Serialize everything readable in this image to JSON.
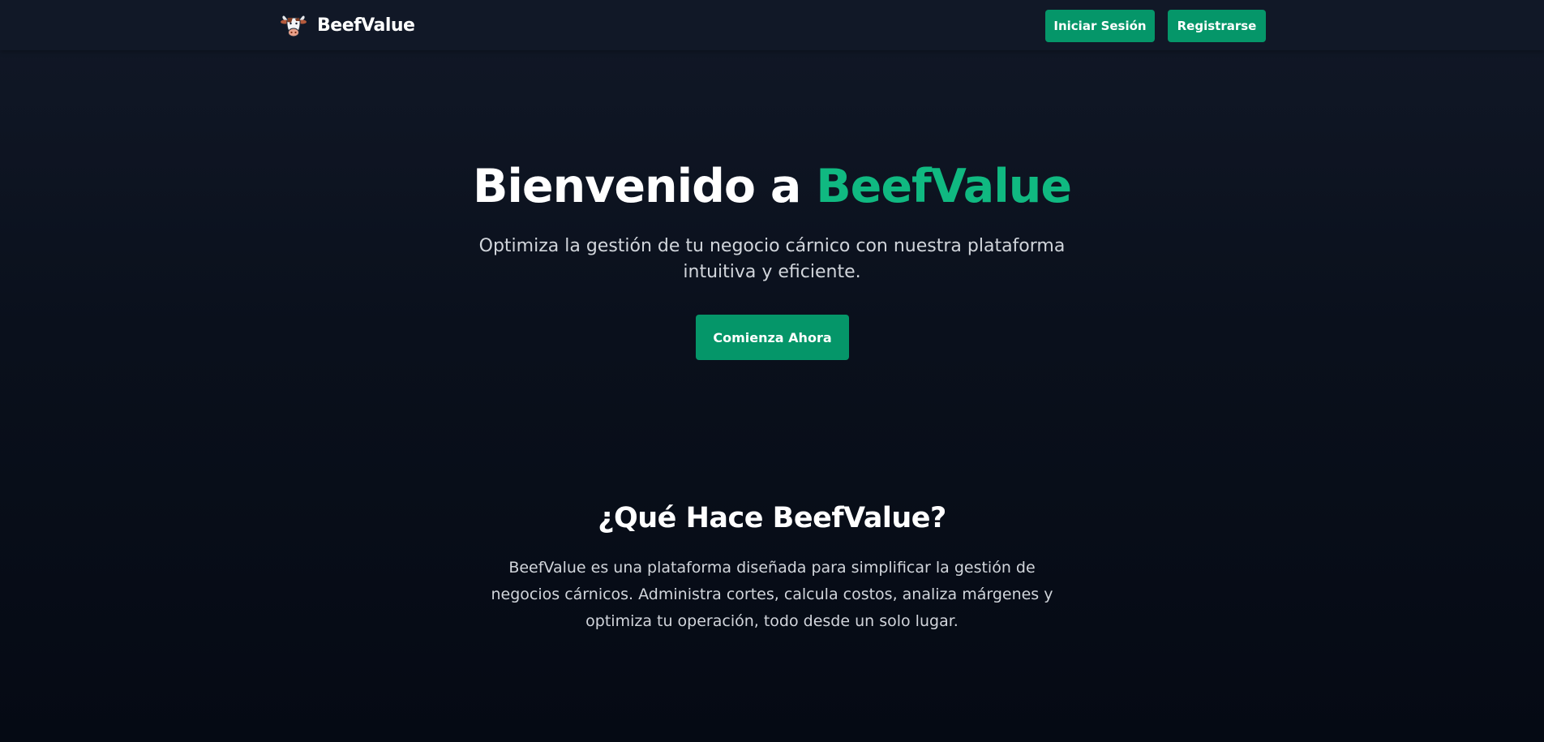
{
  "nav": {
    "brand_name": "BeefValue",
    "brand_icon": "cow-head-icon",
    "login_label": "Iniciar Sesión",
    "register_label": "Registrarse"
  },
  "hero": {
    "title_prefix": "Bienvenido a ",
    "title_accent": "BeefValue",
    "subtitle": "Optimiza la gestión de tu negocio cárnico con nuestra plataforma intuitiva y eficiente.",
    "cta_label": "Comienza Ahora"
  },
  "about": {
    "title": "¿Qué Hace BeefValue?",
    "description": "BeefValue es una plataforma diseñada para simplificar la gestión de negocios cárnicos. Administra cortes, calcula costos, analiza márgenes y optimiza tu operación, todo desde un solo lugar."
  },
  "colors": {
    "accent": "#10b981",
    "button": "#059669",
    "navbar": "#111827",
    "background_top": "#111827",
    "background_bottom": "#050a14"
  }
}
